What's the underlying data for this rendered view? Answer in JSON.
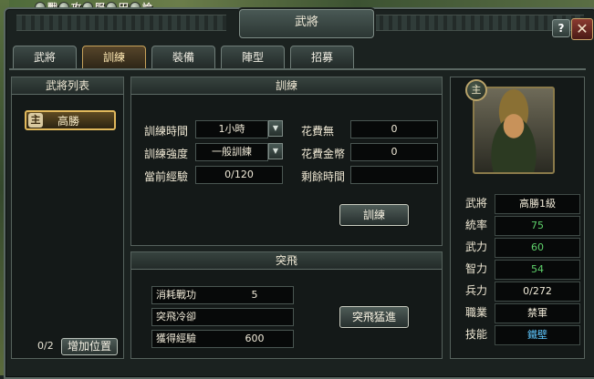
{
  "top_menu": [
    "戰",
    "攻",
    "服",
    "田",
    "論"
  ],
  "window": {
    "title": "武將"
  },
  "controls": {
    "help": "?",
    "close": "✕"
  },
  "tabs": [
    {
      "label": "武將",
      "active": false
    },
    {
      "label": "訓練",
      "active": true
    },
    {
      "label": "裝備",
      "active": false
    },
    {
      "label": "陣型",
      "active": false
    },
    {
      "label": "招募",
      "active": false
    }
  ],
  "roster": {
    "header": "武將列表",
    "items": [
      {
        "badge": "主",
        "name": "高勝"
      }
    ],
    "count": "0/2",
    "add_button": "增加位置"
  },
  "training": {
    "header": "訓練",
    "time_label": "訓練時間",
    "time_value": "1小時",
    "intensity_label": "訓練強度",
    "intensity_value": "一般訓練",
    "exp_label": "當前經驗",
    "exp_value": "0/120",
    "cost_label": "花費無",
    "cost_value": "0",
    "gold_label": "花費金幣",
    "gold_value": "0",
    "remaining_label": "剩餘時間",
    "remaining_value": "",
    "train_button": "訓練"
  },
  "breakthrough": {
    "header": "突飛",
    "merit_label": "消耗戰功",
    "merit_value": "5",
    "cooldown_label": "突飛冷卻",
    "cooldown_value": "",
    "gain_label": "獲得經驗",
    "gain_value": "600",
    "button": "突飛猛進"
  },
  "general": {
    "portrait_badge": "主",
    "stats": [
      {
        "label": "武將",
        "value": "高勝1級",
        "color": "#f0ead8"
      },
      {
        "label": "統率",
        "value": "75",
        "color": "#5ed06a"
      },
      {
        "label": "武力",
        "value": "60",
        "color": "#5ed06a"
      },
      {
        "label": "智力",
        "value": "54",
        "color": "#5ed06a"
      },
      {
        "label": "兵力",
        "value": "0/272",
        "color": "#f0ead8"
      },
      {
        "label": "職業",
        "value": "禁軍",
        "color": "#f0ead8"
      },
      {
        "label": "技能",
        "value": "鐵壁",
        "color": "#5fc8ff"
      }
    ]
  }
}
